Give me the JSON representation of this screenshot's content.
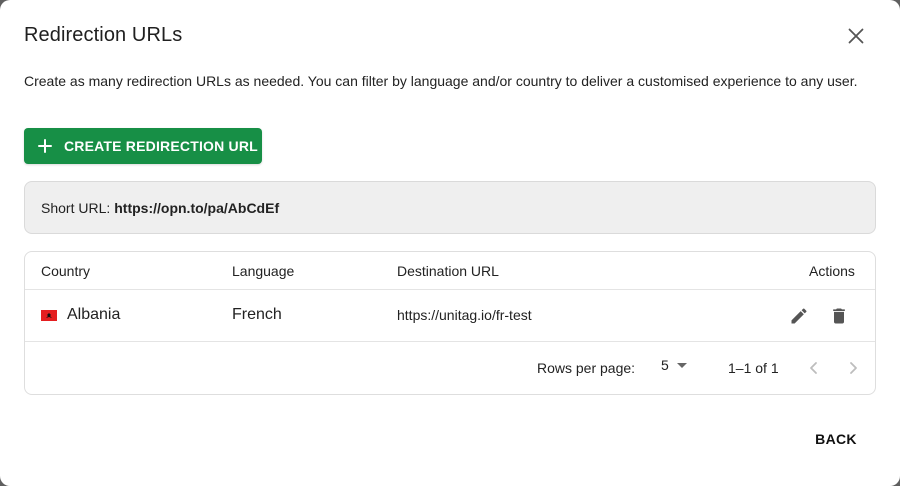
{
  "dialog": {
    "title": "Redirection URLs",
    "description": "Create as many redirection URLs as needed. You can filter by language and/or country to deliver a customised experience to any user.",
    "create_button_label": "CREATE REDIRECTION URL",
    "short_url_label": "Short URL:",
    "short_url_value": "https://opn.to/pa/AbCdEf",
    "back_label": "BACK"
  },
  "table": {
    "headers": {
      "country": "Country",
      "language": "Language",
      "destination": "Destination URL",
      "actions": "Actions"
    },
    "rows": [
      {
        "country": "Albania",
        "language": "French",
        "destination": "https://unitag.io/fr-test",
        "actions": [
          "edit-icon",
          "delete-icon"
        ]
      }
    ],
    "pagination": {
      "rows_per_page_label": "Rows per page:",
      "rows_per_page_value": "5",
      "range": "1–1 of 1"
    }
  },
  "colors": {
    "primary_green": "#178f46",
    "flag_red": "#e41e20",
    "short_url_bg": "#efefef"
  }
}
